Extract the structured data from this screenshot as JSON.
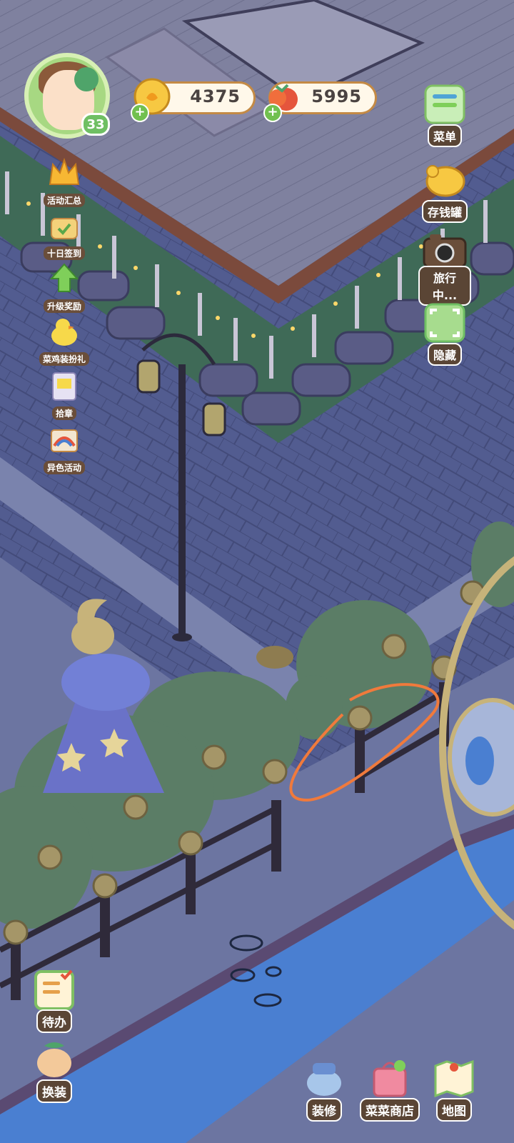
{
  "player": {
    "level": "33"
  },
  "currencies": {
    "coins": {
      "amount": "4375",
      "icon": "gold-coin-icon"
    },
    "vegetables": {
      "amount": "5995",
      "icon": "carrot-tomato-icon"
    }
  },
  "left_menu": [
    {
      "label": "活动汇总",
      "icon": "crown-icon"
    },
    {
      "label": "十日签到",
      "icon": "checkin-basket-icon"
    },
    {
      "label": "升级奖励",
      "icon": "level-up-arrow-icon"
    },
    {
      "label": "菜鸡装扮礼",
      "icon": "yellow-chick-icon"
    },
    {
      "label": "拾章",
      "icon": "sticker-book-icon"
    },
    {
      "label": "异色活动",
      "icon": "rainbow-card-icon"
    }
  ],
  "right_menu": [
    {
      "label": "菜单",
      "icon": "menu-list-icon"
    },
    {
      "label": "存钱罐",
      "icon": "piggy-bank-icon"
    },
    {
      "label": "旅行中...",
      "icon": "camera-icon"
    },
    {
      "label": "隐藏",
      "icon": "hide-frame-icon"
    }
  ],
  "bottom_left": [
    {
      "label": "待办",
      "icon": "todo-calendar-icon"
    },
    {
      "label": "换装",
      "icon": "dress-up-icon"
    }
  ],
  "bottom_right": [
    {
      "label": "装修",
      "icon": "decorate-duck-icon"
    },
    {
      "label": "菜菜商店",
      "icon": "shop-bag-icon"
    },
    {
      "label": "地图",
      "icon": "map-icon"
    }
  ],
  "colors": {
    "ground": "#4f5a8c",
    "deck": "#7d7f9e",
    "hedge": "#5b7d66",
    "water": "#4a7fd1",
    "annotation": "#f07a3c"
  }
}
